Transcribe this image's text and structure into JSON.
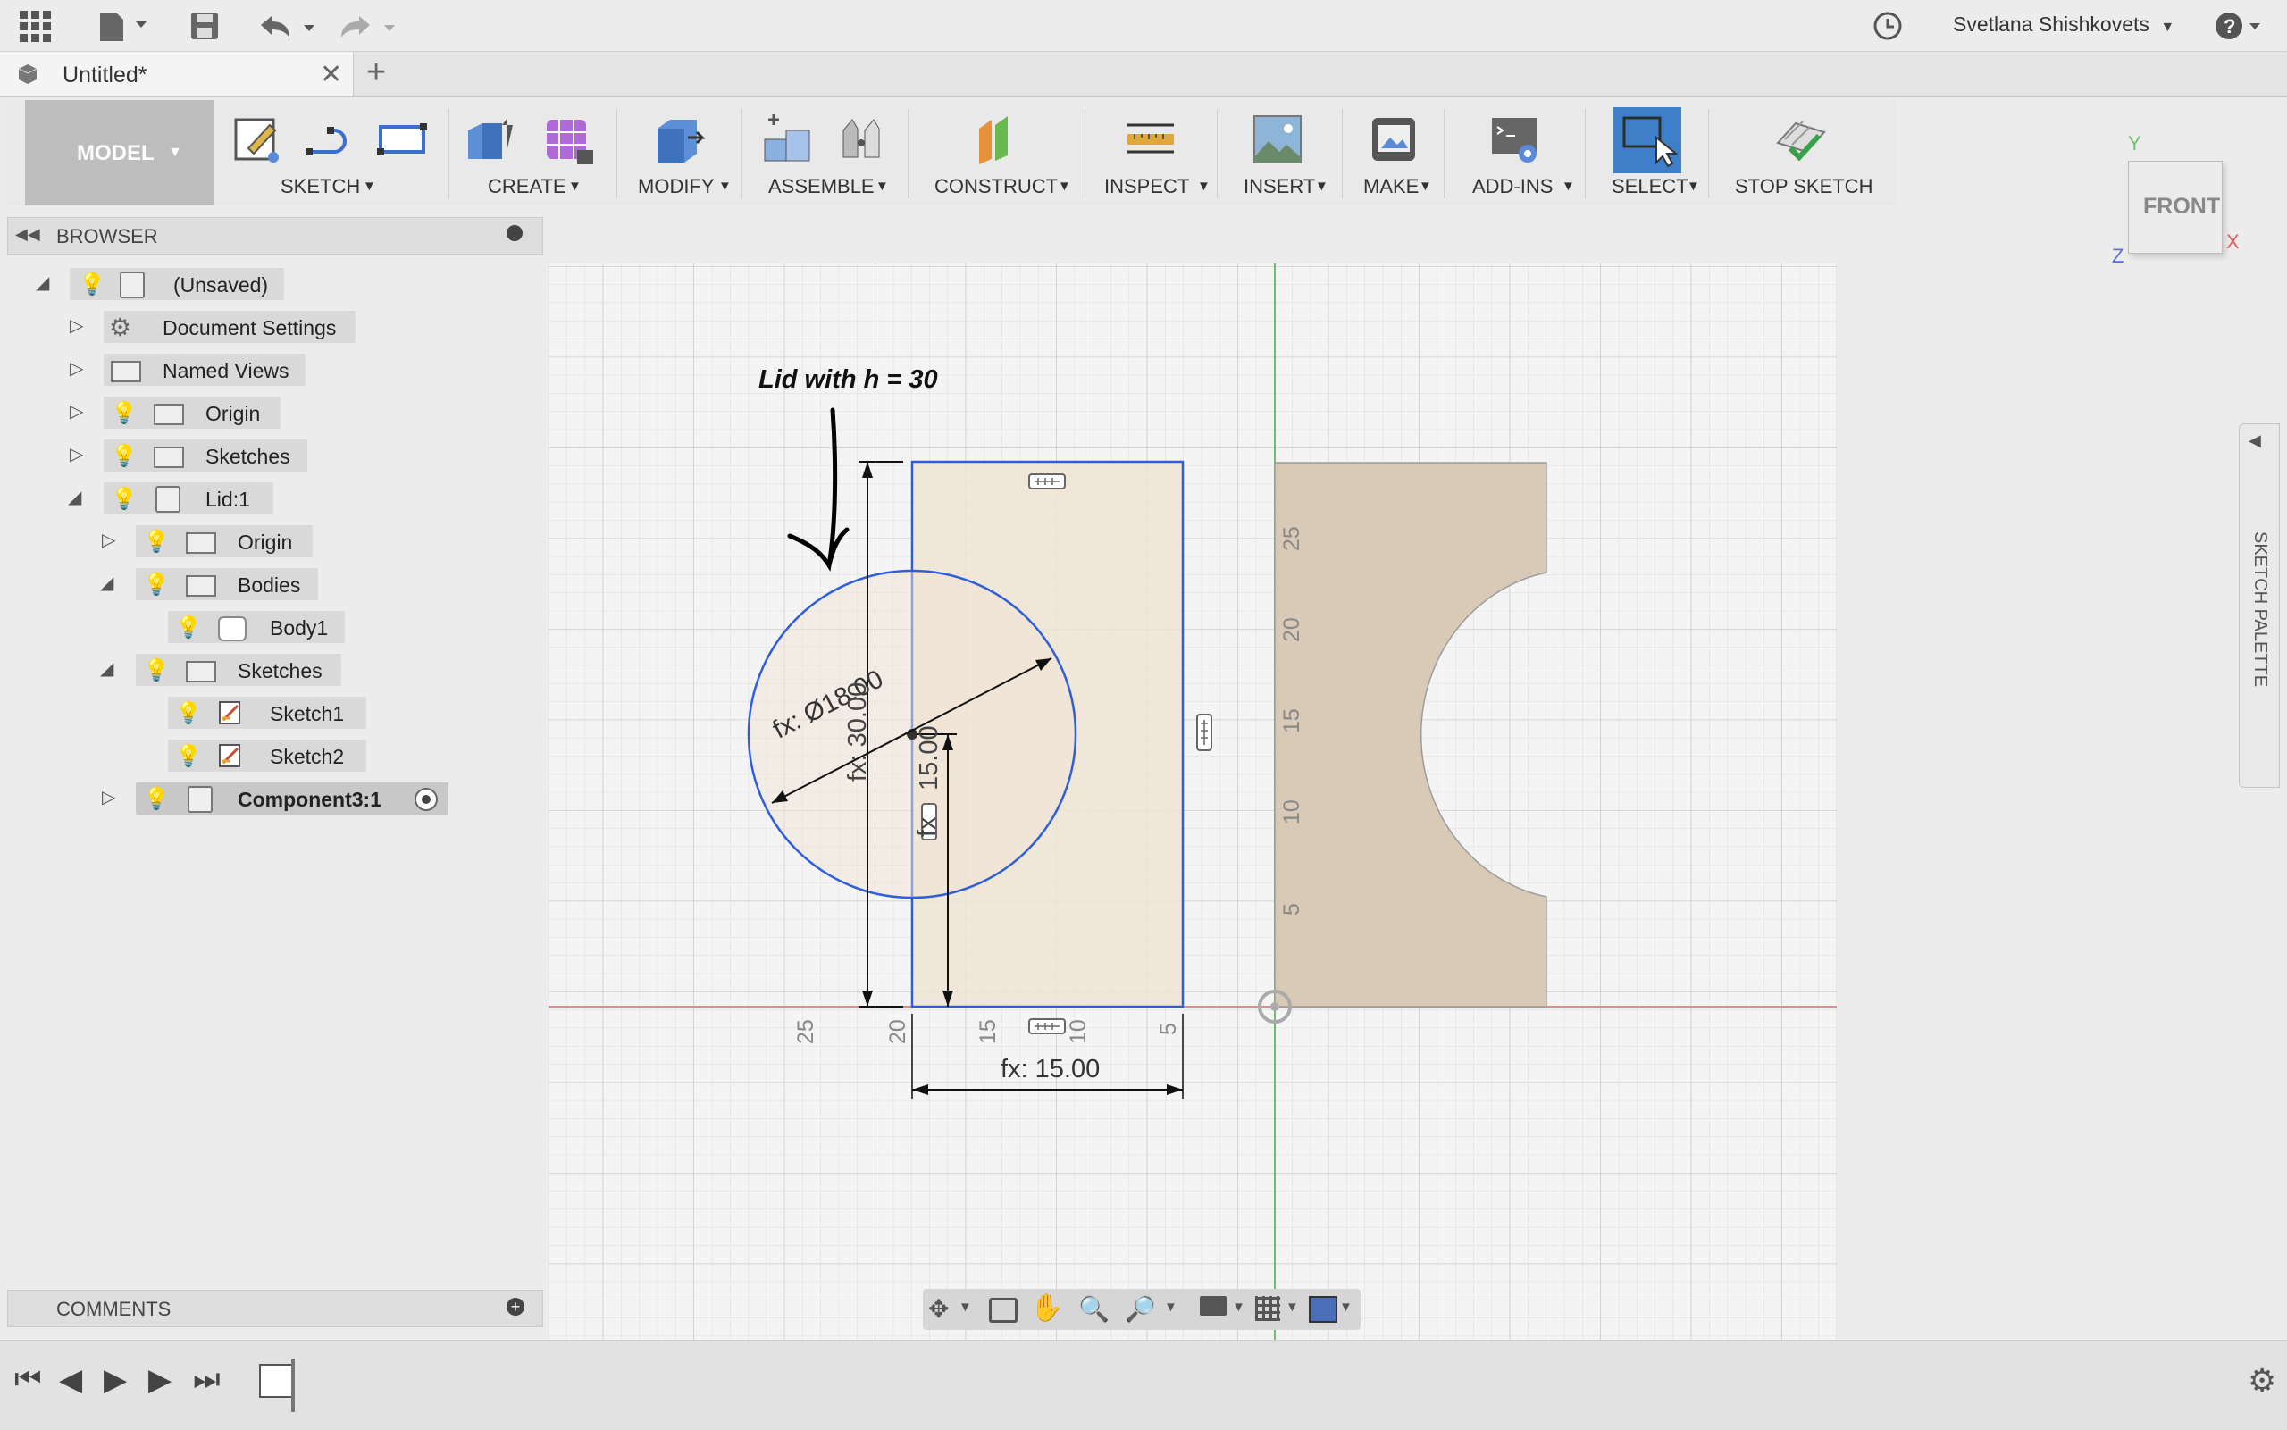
{
  "topbar": {
    "user_name": "Svetlana Shishkovets",
    "icons": [
      "grid-menu-icon",
      "file-icon",
      "save-icon",
      "undo-icon",
      "redo-icon",
      "history-clock-icon",
      "help-icon"
    ]
  },
  "tab": {
    "title": "Untitled*"
  },
  "toolbar": {
    "workspace": "MODEL",
    "groups": [
      "SKETCH",
      "CREATE",
      "MODIFY",
      "ASSEMBLE",
      "CONSTRUCT",
      "INSPECT",
      "INSERT",
      "MAKE",
      "ADD-INS",
      "SELECT",
      "STOP SKETCH"
    ]
  },
  "viewcube": {
    "face": "FRONT",
    "axis_y": "Y",
    "axis_x": "X",
    "axis_z": "Z"
  },
  "browser": {
    "title": "BROWSER",
    "items": [
      {
        "label": "(Unsaved)"
      },
      {
        "label": "Document Settings"
      },
      {
        "label": "Named Views"
      },
      {
        "label": "Origin"
      },
      {
        "label": "Sketches"
      },
      {
        "label": "Lid:1"
      },
      {
        "label": "Origin"
      },
      {
        "label": "Bodies"
      },
      {
        "label": "Body1"
      },
      {
        "label": "Sketches"
      },
      {
        "label": "Sketch1"
      },
      {
        "label": "Sketch2"
      },
      {
        "label": "Component3:1"
      }
    ]
  },
  "comments": {
    "title": "COMMENTS"
  },
  "sketch_palette": {
    "title": "SKETCH PALETTE"
  },
  "canvas": {
    "annotation": "Lid with h = 30",
    "dim_diameter": "fx: Ø18.00",
    "dim_height_overlap": "fx: 30.00",
    "dim_vertical": "15.00",
    "dim_vertical_prefix": "fx",
    "dim_horizontal": "fx: 15.00",
    "ruler_bottom": [
      "25",
      "20",
      "15",
      "10",
      "5"
    ],
    "ruler_side": [
      "25",
      "20",
      "15",
      "10",
      "5"
    ],
    "colors": {
      "sketch_blue": "#2f5fd8",
      "fill": "#efe4d4",
      "body": "#d9cab7",
      "axis_red": "#e38a8a",
      "axis_green": "#6dbf6d"
    }
  }
}
